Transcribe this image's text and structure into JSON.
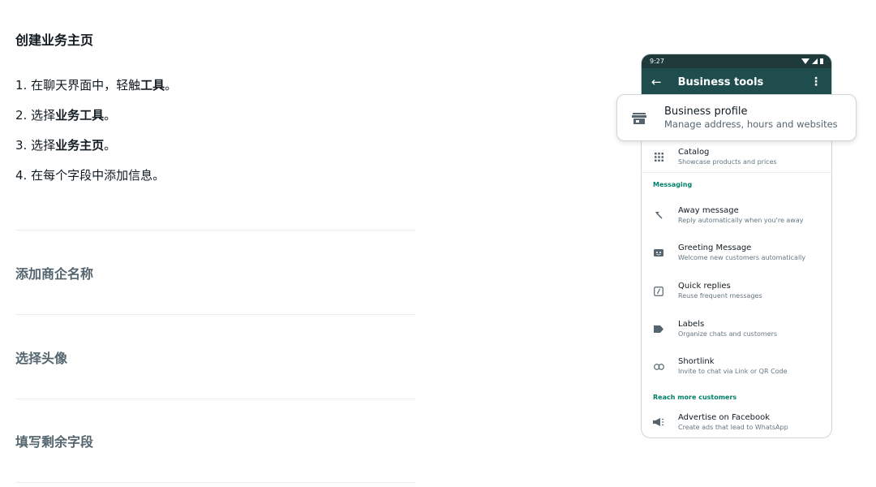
{
  "section": {
    "title": "创建业务主页"
  },
  "steps": [
    {
      "prefix": "1. 在聊天界面中，轻触",
      "bold": "工具",
      "suffix": "。"
    },
    {
      "prefix": "2. 选择",
      "bold": "业务工具",
      "suffix": "。"
    },
    {
      "prefix": "3. 选择",
      "bold": "业务主页",
      "suffix": "。"
    },
    {
      "prefix": "4. 在每个字段中添加信息。",
      "bold": "",
      "suffix": ""
    }
  ],
  "accordion": [
    {
      "label": "添加商企名称"
    },
    {
      "label": "选择头像"
    },
    {
      "label": "填写剩余字段"
    }
  ],
  "phone": {
    "time": "9:27",
    "title": "Business tools",
    "profile_card": {
      "title": "Business profile",
      "subtitle": "Manage address, hours and websites",
      "icon": "store-icon"
    },
    "catalog": {
      "title": "Catalog",
      "subtitle": "Showcase products and prices",
      "icon": "grid-icon"
    },
    "messaging_label": "Messaging",
    "messaging": [
      {
        "title": "Away message",
        "subtitle": "Reply automatically when you're away",
        "icon": "away-icon"
      },
      {
        "title": "Greeting Message",
        "subtitle": "Welcome new customers automatically",
        "icon": "greeting-icon"
      },
      {
        "title": "Quick replies",
        "subtitle": "Reuse frequent messages",
        "icon": "quick-reply-icon"
      },
      {
        "title": "Labels",
        "subtitle": "Organize chats and customers",
        "icon": "label-icon"
      },
      {
        "title": "Shortlink",
        "subtitle": "Invite to chat via Link or QR Code",
        "icon": "link-icon"
      }
    ],
    "reach_label": "Reach more customers",
    "advertise": {
      "title": "Advertise on Facebook",
      "subtitle": "Create ads that lead to WhatsApp",
      "icon": "megaphone-icon"
    }
  },
  "colors": {
    "app_bar": "#1f4c4d",
    "status_bar": "#1f3a3a",
    "accent_green": "#008069"
  }
}
